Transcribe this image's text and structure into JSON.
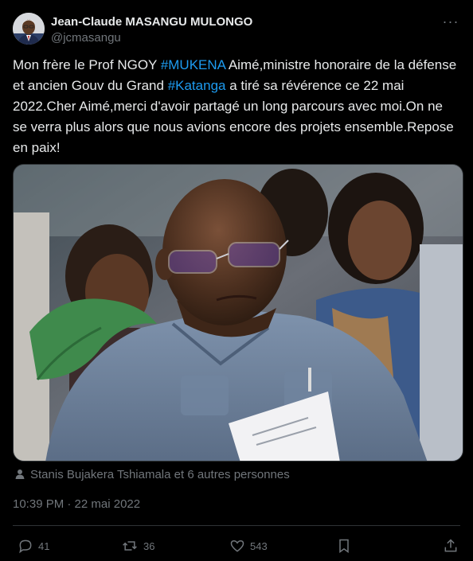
{
  "author": {
    "display_name": "Jean-Claude MASANGU MULONGO",
    "handle": "@jcmasangu"
  },
  "more_label": "···",
  "tweet": {
    "segments": [
      {
        "text": "Mon frère le Prof NGOY ",
        "hashtag": false
      },
      {
        "text": "#MUKENA",
        "hashtag": true
      },
      {
        "text": " Aimé,ministre honoraire de la défense et ancien Gouv du Grand ",
        "hashtag": false
      },
      {
        "text": "#Katanga",
        "hashtag": true
      },
      {
        "text": " a tiré sa révérence ce 22 mai 2022.Cher Aimé,merci d'avoir partagé un long parcours avec moi.On ne se verra plus alors que nous avions encore des projets ensemble.Repose en paix!",
        "hashtag": false
      }
    ]
  },
  "media": {
    "icon": "photo-of-man-with-glasses"
  },
  "tagged_people": "Stanis Bujakera Tshiamala et 6 autres personnes",
  "timestamp": "10:39 PM · 22 mai 2022",
  "actions": {
    "replies": "41",
    "reposts": "36",
    "likes": "543"
  },
  "colors": {
    "background": "#000000",
    "text": "#e7e9ea",
    "secondary": "#71767b",
    "link": "#1d9bf0",
    "border": "#2f3336"
  }
}
